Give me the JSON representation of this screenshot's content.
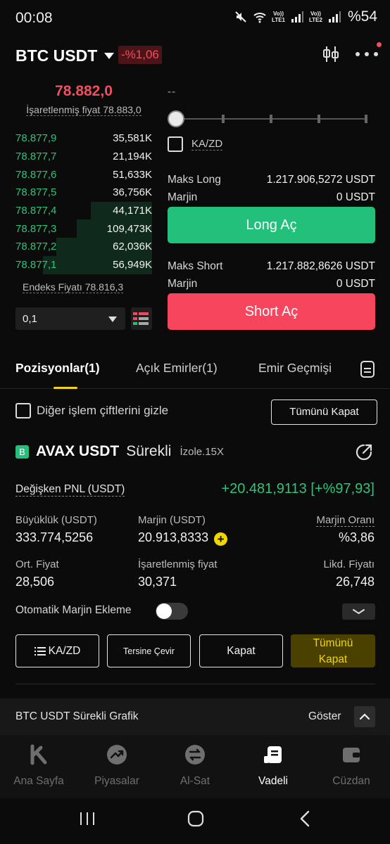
{
  "status_bar": {
    "time": "00:08",
    "lte1_label": "Vo)) LTE1",
    "lte2_label": "Vo)) LTE2",
    "battery": "%54"
  },
  "header": {
    "pair": "BTC USDT",
    "change": "-%1,06",
    "icons": [
      "candlestick-settings-icon",
      "more-icon"
    ]
  },
  "order_book": {
    "last_price": "78.882,0",
    "mark_price_label": "İşaretlenmiş fiyat 78.883,0",
    "rows": [
      {
        "price": "78.877,9",
        "qty": "35,581K",
        "depth": 0.0
      },
      {
        "price": "78.877,7",
        "qty": "21,194K",
        "depth": 0.0
      },
      {
        "price": "78.877,6",
        "qty": "51,633K",
        "depth": 0.0
      },
      {
        "price": "78.877,5",
        "qty": "36,756K",
        "depth": 0.0
      },
      {
        "price": "78.877,4",
        "qty": "44,171K",
        "depth": 0.45
      },
      {
        "price": "78.877,3",
        "qty": "109,473K",
        "depth": 0.55
      },
      {
        "price": "78.877,2",
        "qty": "62,036K",
        "depth": 0.7
      },
      {
        "price": "78.877,1",
        "qty": "56,949K",
        "depth": 0.8
      }
    ],
    "index_price_label": "Endeks Fiyatı 78.816,3",
    "step_value": "0,1"
  },
  "trade_panel": {
    "amount_placeholder": "--",
    "slider_percent": 0,
    "kazd_label": "KA/ZD",
    "max_long_label": "Maks Long",
    "max_long_value": "1.217.906,5272 USDT",
    "margin_label": "Marjin",
    "margin_long_value": "0 USDT",
    "long_button": "Long Aç",
    "max_short_label": "Maks Short",
    "max_short_value": "1.217.882,8626 USDT",
    "margin_short_value": "0 USDT",
    "short_button": "Short Aç"
  },
  "tabs": {
    "positions": "Pozisyonlar(1)",
    "open_orders": "Açık Emirler(1)",
    "order_history": "Emir Geçmişi"
  },
  "positions": {
    "hide_other_pairs": "Diğer işlem çiftlerini gizle",
    "close_all": "Tümünü Kapat",
    "side_badge": "B",
    "symbol": "AVAX USDT",
    "contract_type": "Sürekli",
    "leverage": "İzole.15X",
    "pnl_label": "Değişken PNL (USDT)",
    "pnl_value": "+20.481,9113 [+%97,93]",
    "size_label": "Büyüklük (USDT)",
    "size_value": "333.774,5256",
    "margin_label": "Marjin (USDT)",
    "margin_value": "20.913,8333",
    "margin_ratio_label": "Marjin Oranı",
    "margin_ratio_value": "%3,86",
    "avg_price_label": "Ort. Fiyat",
    "avg_price_value": "28,506",
    "mark_price_label": "İşaretlenmiş fiyat",
    "mark_price_value": "30,371",
    "liq_price_label": "Likd. Fiyatı",
    "liq_price_value": "26,748",
    "auto_margin_label": "Otomatik Marjin Ekleme",
    "auto_margin_on": false,
    "btn_kazd": "KA/ZD",
    "btn_reverse": "Tersine Çevir",
    "btn_close": "Kapat",
    "btn_close_all": "Tümünü Kapat"
  },
  "chart_bar": {
    "title": "BTC USDT Sürekli Grafik",
    "show": "Göster"
  },
  "bottom_nav": {
    "items": [
      {
        "label": "Ana Sayfa",
        "icon": "home-k-icon"
      },
      {
        "label": "Piyasalar",
        "icon": "markets-icon"
      },
      {
        "label": "Al-Sat",
        "icon": "trade-icon"
      },
      {
        "label": "Vadeli",
        "icon": "futures-icon"
      },
      {
        "label": "Cüzdan",
        "icon": "wallet-icon"
      }
    ],
    "active": "Vadeli"
  },
  "colors": {
    "green": "#23c07b",
    "red": "#f7455d",
    "yellow": "#f0d700",
    "background": "#0b0b0b"
  }
}
